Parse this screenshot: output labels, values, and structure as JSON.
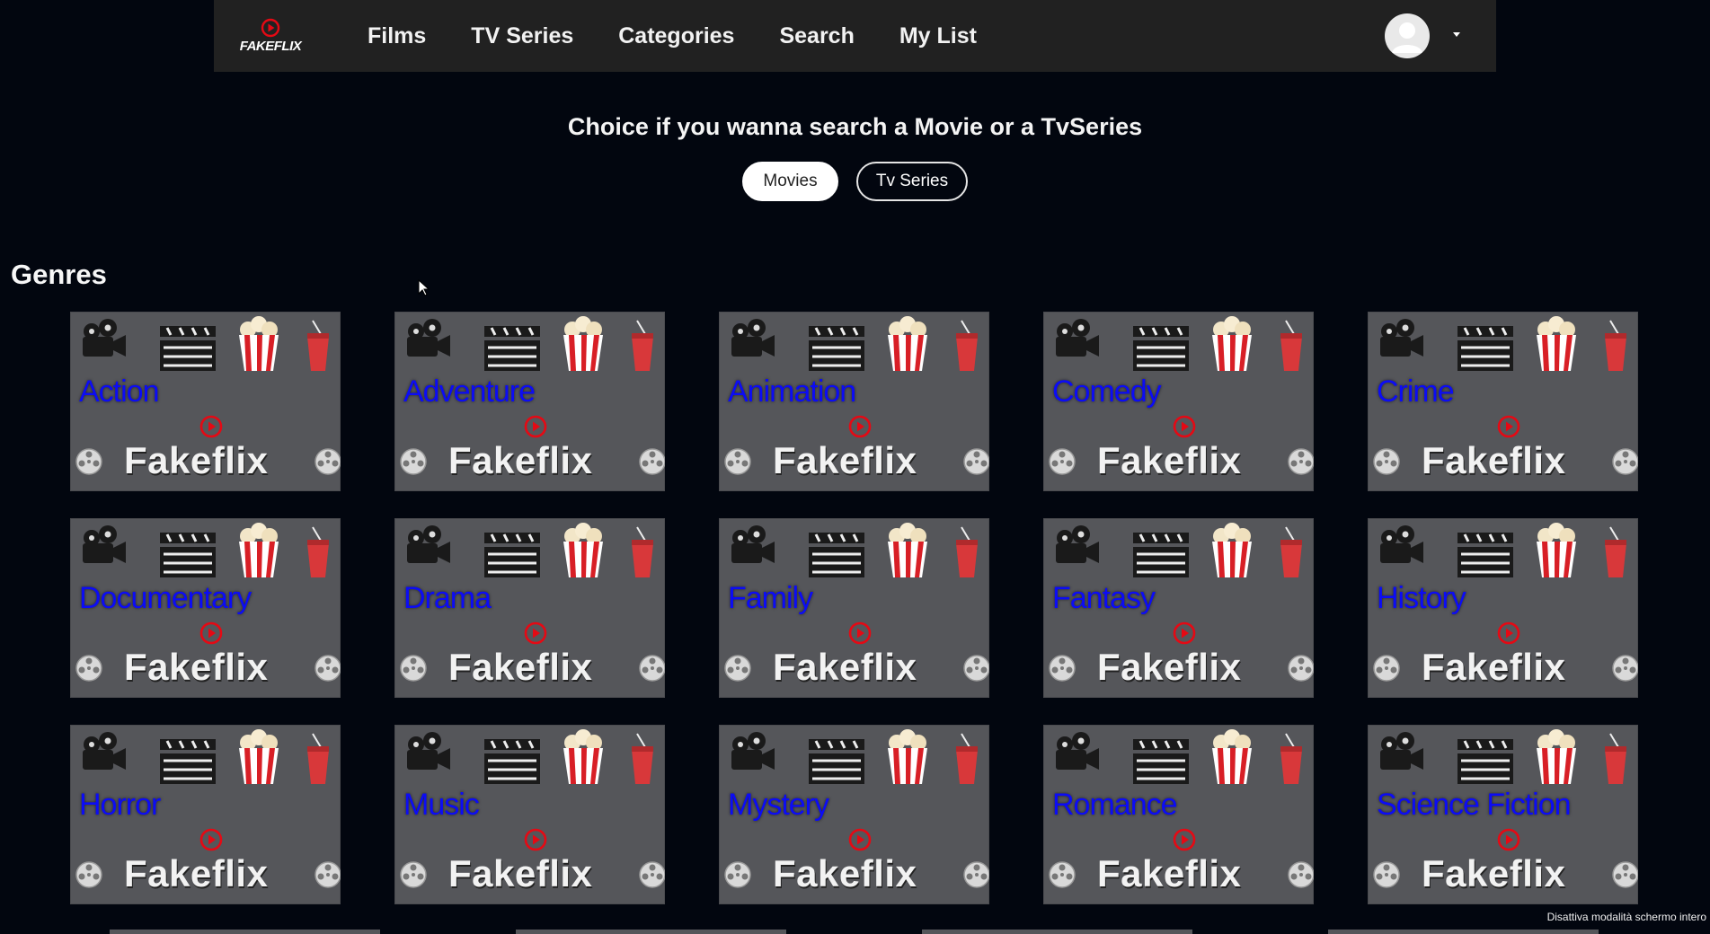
{
  "app": {
    "logo_text": "FAKEFLIX"
  },
  "nav": {
    "items": [
      {
        "label": "Films"
      },
      {
        "label": "TV Series"
      },
      {
        "label": "Categories"
      },
      {
        "label": "Search"
      },
      {
        "label": "My List"
      }
    ],
    "avatar_icon": "user-avatar-icon",
    "menu_icon": "caret-down-icon"
  },
  "search_choice": {
    "headline": "Choice if you wanna search a Movie or a TvSeries",
    "movies_label": "Movies",
    "tvseries_label": "Tv Series",
    "selected": "Movies"
  },
  "genres": {
    "title": "Genres",
    "card_brand": "Fakeflix",
    "items": [
      {
        "label": "Action"
      },
      {
        "label": "Adventure"
      },
      {
        "label": "Animation"
      },
      {
        "label": "Comedy"
      },
      {
        "label": "Crime"
      },
      {
        "label": "Documentary"
      },
      {
        "label": "Drama"
      },
      {
        "label": "Family"
      },
      {
        "label": "Fantasy"
      },
      {
        "label": "History"
      },
      {
        "label": "Horror"
      },
      {
        "label": "Music"
      },
      {
        "label": "Mystery"
      },
      {
        "label": "Romance"
      },
      {
        "label": "Science Fiction"
      }
    ]
  },
  "system": {
    "exit_fullscreen": "Disattiva modalità schermo intero"
  },
  "colors": {
    "accent": "#e50914",
    "genre_text": "#0c0cf5",
    "card_bg": "#55565a"
  }
}
